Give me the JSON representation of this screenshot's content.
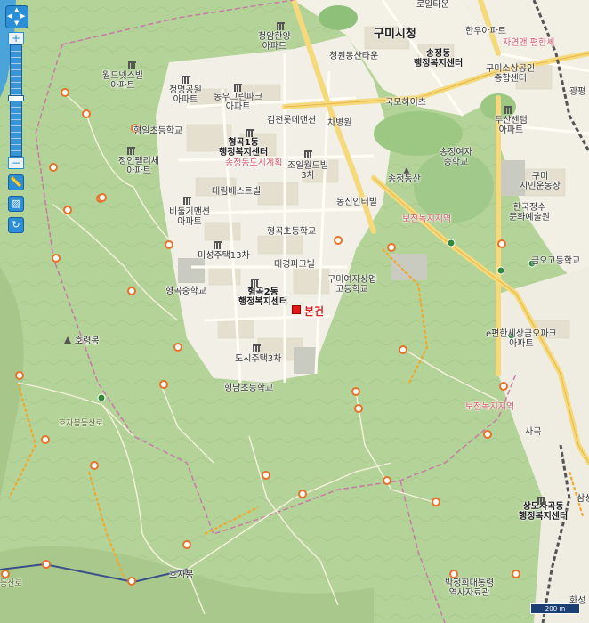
{
  "map": {
    "labels": {
      "city_hall": "구미시청",
      "songjeong_office": "송정동\n행정복지센터",
      "hyeonggok1_office": "형곡1동\n행정복지센터",
      "hyeonggok2_office": "형곡2동\n행정복지센터",
      "sangmosagok_office": "상모사곡동\n행정복지센터",
      "target": "본건",
      "ruins": "로얄타운",
      "cheongam": "청암한양\n아파트",
      "cheongwon": "청원동산타운",
      "hanwoo": "한우아파트",
      "jayeon": "자연앤 편한세",
      "gumi_sobo": "구미소상공인\n종합센터",
      "gwangpyeong": "광평",
      "worldnet": "월드넷스빌\n아파트",
      "cheongmyeong": "청명공원\n아파트",
      "dongwoo": "동우그린파크\n아파트",
      "gimcheon": "김천롯데맨션",
      "jaebyeongwon": "차병원",
      "gukmo": "국모하이츠",
      "dusan": "두산센텀\n아파트",
      "hyeongil_school": "형일초등학교",
      "jeongin": "정인펠리체\n아파트",
      "songjeong_girls": "송정여자\n중학교",
      "joil": "조일월드빌\n3차",
      "songjeongdongsan": "송정동산",
      "gumi_stadium": "구미\n시민운동장",
      "daelim": "대림베스트빌",
      "dongsin": "동신인터빌",
      "bidulgi": "비둘기맨션\n아파트",
      "hanguk_culture": "한국정수\n문화예술원",
      "hyeonggok_elem": "형곡초등학교",
      "misung": "미성주택13차",
      "daegyeong": "대경파크빌",
      "geumo_high": "금오고등학교",
      "hyeonggok_middle": "형곡중학교",
      "gumi_girls_high": "구미여자상업\n고등학교",
      "horyeongbong": "호령봉",
      "ecopark": "e편한세상금오파크\n아파트",
      "doshi": "도시주택3차",
      "hyeongnam": "형남초등학교",
      "hojabong_road": "호자봉등산로",
      "bojeon": "보전녹지지역",
      "sagok": "사곡",
      "samsung": "삼성",
      "hojabong": "호자봉",
      "bakjeonghui": "박정희대통령\n역사자료관",
      "hwasung": "화성",
      "songjeong_dojigu": "송정동도시계획",
      "greenzone": "보전녹지지역",
      "course": "등산로"
    },
    "scale_label": "200 m"
  },
  "toolbar": {
    "zoom_in": "+",
    "zoom_out": "−",
    "distance_icon": "ruler-icon",
    "area_icon": "area-icon",
    "refresh_icon": "refresh-icon"
  }
}
